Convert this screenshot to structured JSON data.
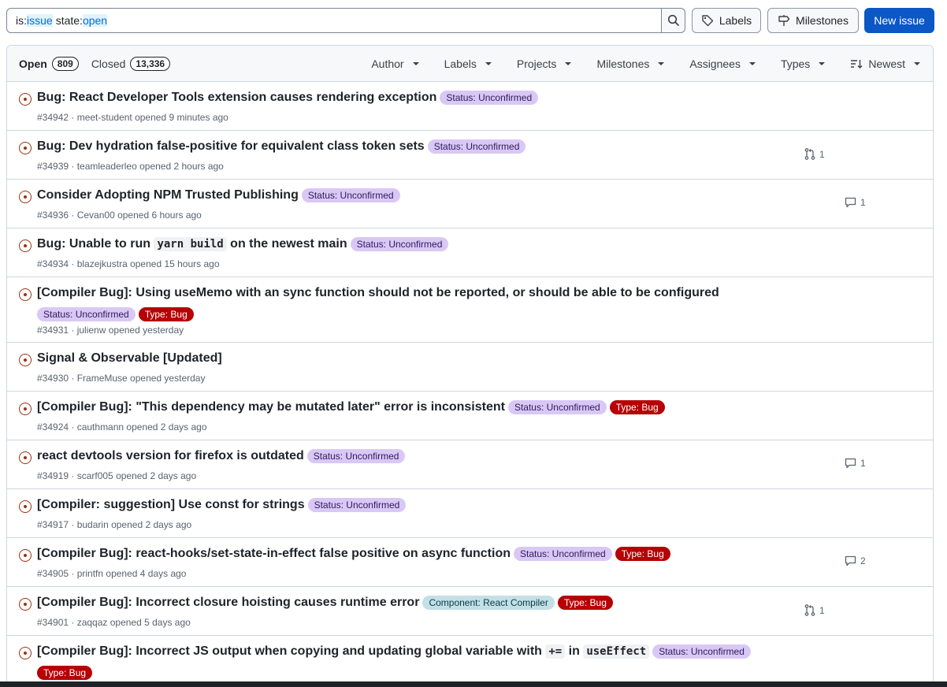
{
  "search": {
    "key1": "is:",
    "val1": "issue",
    "key2": "state:",
    "val2": "open"
  },
  "buttons": {
    "labels": "Labels",
    "milestones": "Milestones",
    "new_issue": "New issue"
  },
  "tabs": {
    "open_label": "Open",
    "open_count": "809",
    "closed_label": "Closed",
    "closed_count": "13,336"
  },
  "filters": [
    "Author",
    "Labels",
    "Projects",
    "Milestones",
    "Assignees",
    "Types",
    "Newest"
  ],
  "issues": [
    {
      "title": "Bug: React Developer Tools extension causes rendering exception",
      "meta": "#34942 · meet-student opened 9 minutes ago",
      "labels": [
        "Status: Unconfirmed"
      ]
    },
    {
      "title": "Bug: Dev hydration false-positive for equivalent class token sets",
      "meta": "#34939 · teamleaderleo opened 2 hours ago",
      "labels": [
        "Status: Unconfirmed"
      ],
      "pr_count": "1"
    },
    {
      "title": "Consider Adopting NPM Trusted Publishing",
      "meta": "#34936 · Cevan00 opened 6 hours ago",
      "labels": [
        "Status: Unconfirmed"
      ],
      "comment_count": "1"
    },
    {
      "title_pre": "Bug: Unable to run ",
      "title_code": "yarn build",
      "title_post": " on the newest main",
      "meta": "#34934 · blazejkustra opened 15 hours ago",
      "labels": [
        "Status: Unconfirmed"
      ]
    },
    {
      "title": "[Compiler Bug]: Using useMemo with an sync function should not be reported, or should be able to be configured",
      "meta": "#34931 · julienw opened yesterday",
      "labels": [
        "Status: Unconfirmed",
        "Type: Bug"
      ]
    },
    {
      "title": "Signal & Observable [Updated]",
      "meta": "#34930 · FrameMuse opened yesterday",
      "labels": []
    },
    {
      "title": "[Compiler Bug]: \"This dependency may be mutated later\" error is inconsistent",
      "meta": "#34924 · cauthmann opened 2 days ago",
      "labels": [
        "Status: Unconfirmed",
        "Type: Bug"
      ]
    },
    {
      "title": "react devtools version for firefox is outdated",
      "meta": "#34919 · scarf005 opened 2 days ago",
      "labels": [
        "Status: Unconfirmed"
      ],
      "comment_count": "1"
    },
    {
      "title": "[Compiler: suggestion] Use const for strings",
      "meta": "#34917 · budarin opened 2 days ago",
      "labels": [
        "Status: Unconfirmed"
      ]
    },
    {
      "title": "[Compiler Bug]: react-hooks/set-state-in-effect false positive on async function",
      "meta": "#34905 · printfn opened 4 days ago",
      "labels": [
        "Status: Unconfirmed",
        "Type: Bug"
      ],
      "comment_count": "2"
    },
    {
      "title": "[Compiler Bug]: Incorrect closure hoisting causes runtime error",
      "meta": "#34901 · zaqqaz opened 5 days ago",
      "labels": [
        "Component: React Compiler",
        "Type: Bug"
      ],
      "pr_count": "1"
    },
    {
      "title_pre": "[Compiler Bug]: Incorrect JS output when copying and updating global variable with ",
      "title_code": "+=",
      "title_mid": " in ",
      "title_code2": "useEffect",
      "labels": [
        "Status: Unconfirmed",
        "Type: Bug"
      ]
    }
  ],
  "colors": {
    "primary_button": "#0b57c5",
    "status_label": "#d9c8f5",
    "bug_label": "#b60205",
    "component_label": "#c2e0e6",
    "open_issue_icon": "#9a3412"
  }
}
